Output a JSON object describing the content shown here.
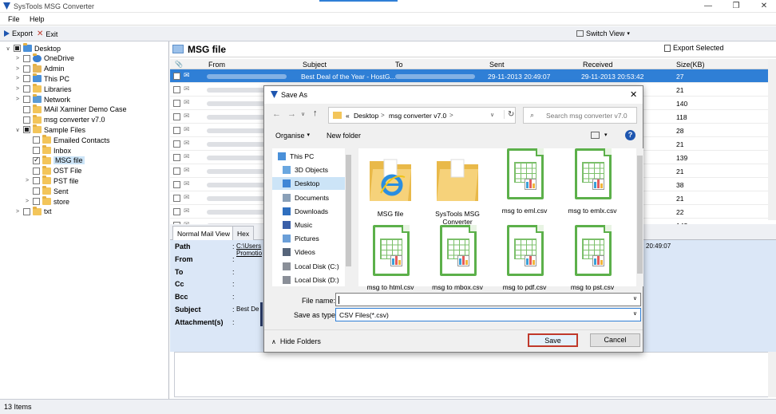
{
  "window": {
    "title": "SysTools MSG Converter",
    "minimize_glyph": "—",
    "restore_glyph": "❐",
    "close_glyph": "✕"
  },
  "menu": {
    "file": "File",
    "help": "Help"
  },
  "toolbar": {
    "export": "Export",
    "exit": "Exit",
    "switch_view": "Switch View",
    "export_selected": "Export Selected"
  },
  "tree": [
    {
      "label": "Desktop",
      "level": 0,
      "expander": "∨",
      "check": "part",
      "icon": "desktop-icon"
    },
    {
      "label": "OneDrive",
      "level": 1,
      "expander": ">",
      "check": "none",
      "icon": "cloud-icon"
    },
    {
      "label": "Admin",
      "level": 1,
      "expander": ">",
      "check": "none",
      "icon": "user-icon"
    },
    {
      "label": "This PC",
      "level": 1,
      "expander": ">",
      "check": "none",
      "icon": "computer-icon"
    },
    {
      "label": "Libraries",
      "level": 1,
      "expander": ">",
      "check": "none",
      "icon": "folder-icon"
    },
    {
      "label": "Network",
      "level": 1,
      "expander": ">",
      "check": "none",
      "icon": "network-icon"
    },
    {
      "label": "MAil Xaminer Demo Case",
      "level": 1,
      "expander": "",
      "check": "none",
      "icon": "folder-icon"
    },
    {
      "label": "msg converter v7.0",
      "level": 1,
      "expander": "",
      "check": "none",
      "icon": "folder-icon"
    },
    {
      "label": "Sample Files",
      "level": 1,
      "expander": "∨",
      "check": "part",
      "icon": "folder-icon"
    },
    {
      "label": "Emailed Contacts",
      "level": 2,
      "expander": "",
      "check": "none",
      "icon": "folder-icon"
    },
    {
      "label": "Inbox",
      "level": 2,
      "expander": "",
      "check": "none",
      "icon": "folder-icon"
    },
    {
      "label": "MSG file",
      "level": 2,
      "expander": "",
      "check": "checked",
      "icon": "folder-icon",
      "selected": true
    },
    {
      "label": "OST File",
      "level": 2,
      "expander": "",
      "check": "none",
      "icon": "folder-icon"
    },
    {
      "label": "PST file",
      "level": 2,
      "expander": ">",
      "check": "none",
      "icon": "folder-icon"
    },
    {
      "label": "Sent",
      "level": 2,
      "expander": "",
      "check": "none",
      "icon": "folder-icon"
    },
    {
      "label": "store",
      "level": 2,
      "expander": ">",
      "check": "none",
      "icon": "folder-icon"
    },
    {
      "label": "txt",
      "level": 1,
      "expander": ">",
      "check": "none",
      "icon": "folder-icon"
    }
  ],
  "main": {
    "folder_title": "MSG file",
    "columns": {
      "from": "From",
      "subject": "Subject",
      "to": "To",
      "sent": "Sent",
      "received": "Received",
      "size": "Size(KB)"
    },
    "rows": [
      {
        "subject": "Best Deal of the Year - HostG...",
        "sent": "29-11-2013 20:49:07",
        "received": "29-11-2013 20:53:42",
        "size": "27",
        "selected": true
      },
      {
        "subject": "",
        "sent": "",
        "received": "",
        "size": "21"
      },
      {
        "subject": "",
        "sent": "",
        "received": "",
        "size": "140"
      },
      {
        "subject": "",
        "sent": "",
        "received": "",
        "size": "118"
      },
      {
        "subject": "",
        "sent": "",
        "received": "",
        "size": "28"
      },
      {
        "subject": "",
        "sent": "",
        "received": "",
        "size": "21"
      },
      {
        "subject": "",
        "sent": "",
        "received": "",
        "size": "139"
      },
      {
        "subject": "",
        "sent": "",
        "received": "",
        "size": "21"
      },
      {
        "subject": "",
        "sent": "",
        "received": "",
        "size": "38"
      },
      {
        "subject": "",
        "sent": "",
        "received": "",
        "size": "21"
      },
      {
        "subject": "",
        "sent": "",
        "received": "",
        "size": "22"
      },
      {
        "subject": "",
        "sent": "",
        "received": "",
        "size": "142"
      }
    ],
    "tabs": [
      "Normal Mail View",
      "Hex"
    ],
    "details": {
      "path_label": "Path",
      "path_value": "C:\\Users",
      "path_value2": "Promotio",
      "from_label": "From",
      "to_label": "To",
      "cc_label": "Cc",
      "bcc_label": "Bcc",
      "subject_label": "Subject",
      "subject_value": "Best De",
      "attachments_label": "Attachment(s)",
      "colon": ":",
      "sent_time": "20:49:07"
    }
  },
  "status": {
    "items": "13 Items"
  },
  "dialog": {
    "title": "Save As",
    "close_glyph": "✕",
    "breadcrumb_prefix": "«",
    "breadcrumb": [
      "Desktop",
      "msg converter v7.0"
    ],
    "search_placeholder": "Search msg converter v7.0",
    "organise": "Organise",
    "new_folder": "New folder",
    "nav_items": [
      {
        "label": "This PC",
        "icon": "computer-icon"
      },
      {
        "label": "3D Objects",
        "icon": "cube-icon"
      },
      {
        "label": "Desktop",
        "icon": "desktop-icon",
        "selected": true
      },
      {
        "label": "Documents",
        "icon": "document-icon"
      },
      {
        "label": "Downloads",
        "icon": "download-icon"
      },
      {
        "label": "Music",
        "icon": "music-icon"
      },
      {
        "label": "Pictures",
        "icon": "picture-icon"
      },
      {
        "label": "Videos",
        "icon": "video-icon"
      },
      {
        "label": "Local Disk (C:)",
        "icon": "disk-icon"
      },
      {
        "label": "Local Disk (D:)",
        "icon": "disk-icon"
      }
    ],
    "files": [
      {
        "label": "MSG file",
        "type": "ie-folder"
      },
      {
        "label": "SysTools MSG Converter",
        "type": "folder"
      },
      {
        "label": "msg to eml.csv",
        "type": "csv"
      },
      {
        "label": "msg to emlx.csv",
        "type": "csv"
      },
      {
        "label": "msg to html.csv",
        "type": "csv"
      },
      {
        "label": "msg to mbox.csv",
        "type": "csv"
      },
      {
        "label": "msg to pdf.csv",
        "type": "csv"
      },
      {
        "label": "msg to pst.csv",
        "type": "csv"
      }
    ],
    "file_name_label": "File name:",
    "file_name_value": "",
    "save_type_label": "Save as type:",
    "save_type_value": "CSV Files(*.csv)",
    "hide_folders": "Hide Folders",
    "save": "Save",
    "cancel": "Cancel",
    "help_glyph": "?"
  },
  "colors": {
    "accent": "#2f7fd6",
    "csv_green": "#5cb04a",
    "folder_yellow": "#f3c55a",
    "save_outline": "#c0392b"
  }
}
